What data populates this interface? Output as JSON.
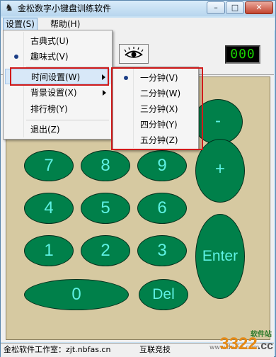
{
  "window": {
    "title": "金松数字小键盘训练软件",
    "controls": {
      "minimize": "–",
      "maximize": "□",
      "close": "✕"
    }
  },
  "menubar": {
    "settings": "设置(S)",
    "help": "帮助(H)"
  },
  "settings_menu": {
    "items": [
      {
        "label": "古典式(U)"
      },
      {
        "label": "趣味式(V)",
        "checked": true
      },
      {
        "label": "时间设置(W)",
        "submenu": true,
        "highlighted": true
      },
      {
        "label": "背景设置(X)",
        "submenu": true
      },
      {
        "label": "排行榜(Y)"
      },
      {
        "label": "退出(Z)"
      }
    ]
  },
  "time_submenu": {
    "items": [
      {
        "label": "一分钟(V)",
        "checked": true
      },
      {
        "label": "二分钟(W)"
      },
      {
        "label": "三分钟(X)"
      },
      {
        "label": "四分钟(Y)"
      },
      {
        "label": "五分钟(Z)"
      }
    ]
  },
  "counter": {
    "value": "000"
  },
  "keypad": {
    "keys": {
      "minus": "-",
      "plus": "+",
      "enter": "Enter",
      "del": "Del",
      "zero": "0",
      "one": "1",
      "two": "2",
      "three": "3",
      "four": "4",
      "five": "5",
      "six": "6",
      "seven": "7",
      "eight": "8",
      "nine": "9"
    }
  },
  "statusbar": {
    "left": "金松软件工作室：zjt.nbfas.cn",
    "right": "互联竞技"
  },
  "watermark": {
    "brand": "3322",
    "suffix": ".cc",
    "tag": "软件站",
    "url": "www.dazi6.com"
  },
  "colors": {
    "key_fill": "#00804a",
    "key_text": "#5ef1e4",
    "pad_bg": "#d6c9a1",
    "counter_digits": "#19d300",
    "highlight_box": "#d11a1a"
  }
}
